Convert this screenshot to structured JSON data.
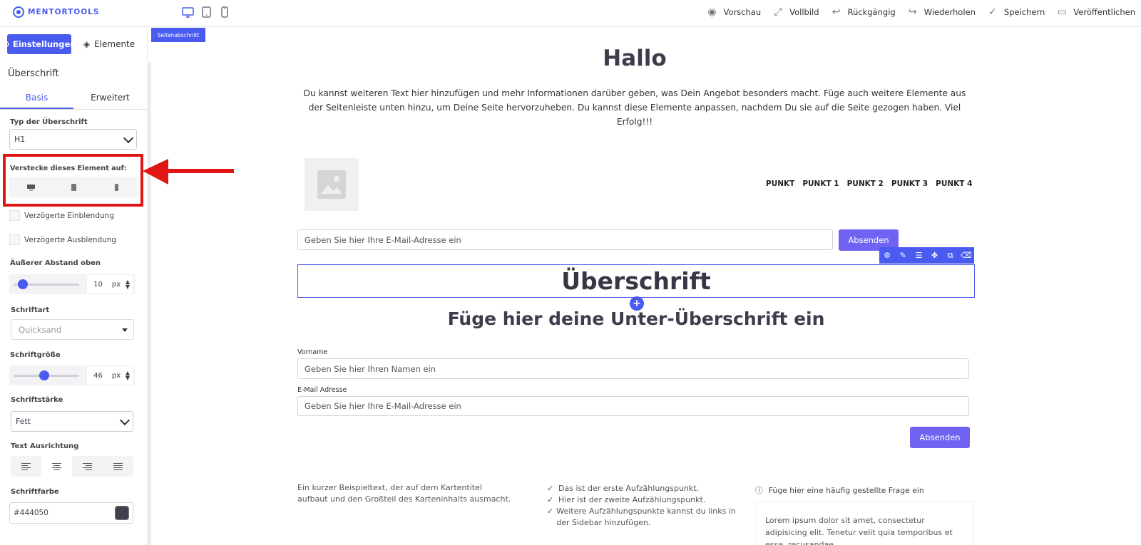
{
  "app": {
    "brand": "MENTORTOOLS",
    "top_actions": [
      {
        "label": "Vorschau",
        "icon": "eye-icon"
      },
      {
        "label": "Vollbild",
        "icon": "expand-icon"
      },
      {
        "label": "Rückgängig",
        "icon": "undo-icon"
      },
      {
        "label": "Wiederholen",
        "icon": "redo-icon"
      },
      {
        "label": "Speichern",
        "icon": "check-icon"
      },
      {
        "label": "Veröffentlichen",
        "icon": "publish-icon"
      }
    ],
    "devices": [
      "desktop-icon",
      "tablet-icon",
      "mobile-icon"
    ]
  },
  "sidebar": {
    "settings_label": "Einstellungen",
    "elements_label": "Elemente",
    "heading": "Überschrift",
    "tabs": [
      "Basis",
      "Erweitert"
    ],
    "heading_type_label": "Typ der Überschrift",
    "heading_type_value": "H1",
    "hide_label": "Verstecke dieses Element auf:",
    "delayed_in": "Verzögerte Einblendung",
    "delayed_out": "Verzögerte Ausblendung",
    "margin_top_label": "Äußerer Abstand oben",
    "margin_top_value": "10",
    "margin_top_level": 0.14,
    "unit": "px",
    "font_label": "Schriftart",
    "font_value": "Quicksand",
    "font_size_label": "Schriftgröße",
    "font_size_value": "46",
    "font_size_level": 0.47,
    "font_weight_label": "Schriftstärke",
    "font_weight_value": "Fett",
    "alignment_label": "Text Ausrichtung",
    "alignment_selected": "center",
    "font_color_label": "Schriftfarbe",
    "font_color_value": "#444050"
  },
  "canvas": {
    "section_label": "Seitenabschnitt",
    "hero_title": "Hallo",
    "hero_text": "Du kannst weiteren Text hier hinzufügen und mehr Informationen darüber geben, was Dein Angebot besonders macht. Füge auch weitere Elemente aus der Seitenleiste unten hinzu, um Deine Seite hervorzuheben. Du kannst diese Elemente anpassen, nachdem Du sie auf die Seite gezogen haben. Viel Erfolg!!!",
    "nav_items": [
      "PUNKT",
      "PUNKT 1",
      "PUNKT 2",
      "PUNKT 3",
      "PUNKT 4"
    ],
    "email_placeholder": "Geben Sie hier Ihre E-Mail-Adresse ein",
    "submit": "Absenden",
    "heading": "Überschrift",
    "subheading": "Füge hier deine Unter-Überschrift ein",
    "first_name_label": "Vorname",
    "first_name_placeholder": "Geben Sie hier Ihren Namen ein",
    "email_label": "E-Mail Adresse",
    "card_text": "Ein kurzer Beispieltext, der auf dem Kartentitel aufbaut und den Großteil des Karteninhalts ausmacht.",
    "checklist": [
      "Das ist der erste Aufzählungspunkt.",
      "Hier ist der zweite Aufzählungspunkt.",
      "Weitere Aufzählungspunkte kannst du links in der Sidebar hinzufügen."
    ],
    "faq_title": "Füge hier eine häufig gestellte Frage ein",
    "faq_text": "Lorem ipsum dolor sit amet, consectetur adipisicing elit. Tenetur velit quia temporibus et esse, recusandae."
  },
  "colors": {
    "accent": "#4a5cf0",
    "button": "#7062f2",
    "annotation": "#e21515",
    "text": "#444050"
  }
}
